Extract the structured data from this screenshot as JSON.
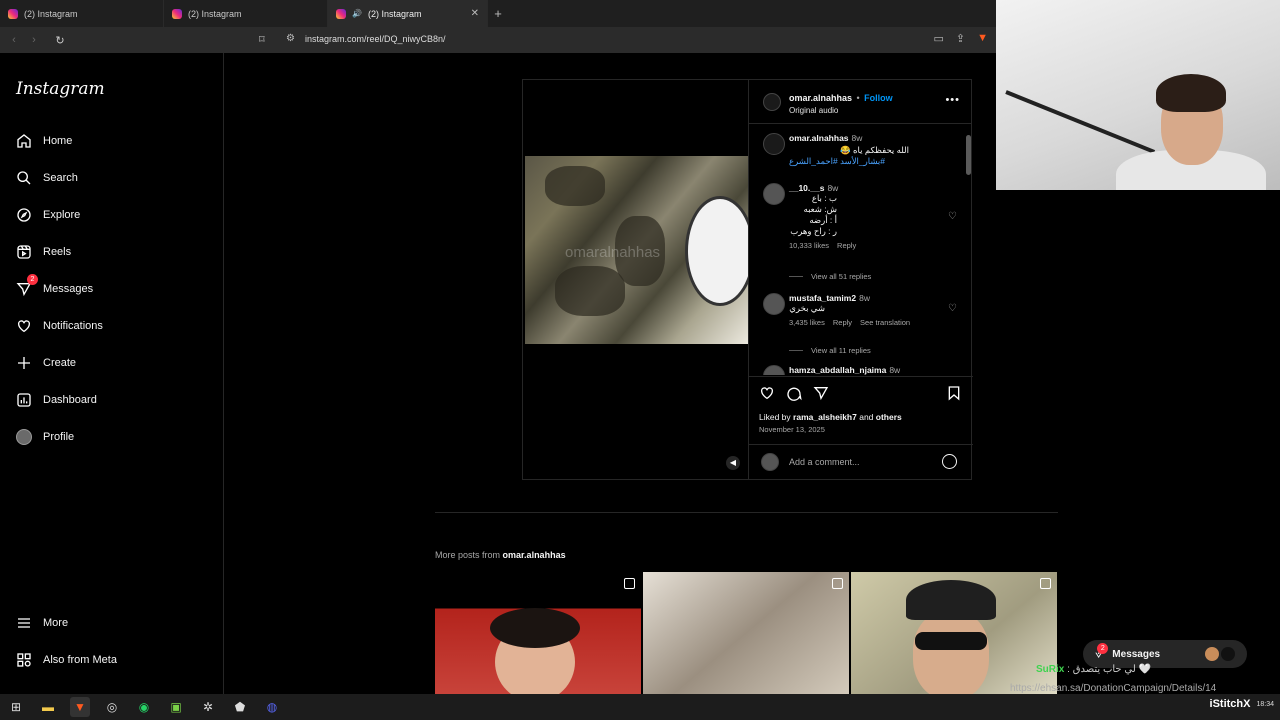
{
  "browser": {
    "tabs": [
      {
        "title": "(2) Instagram"
      },
      {
        "title": "(2) Instagram"
      },
      {
        "title": "(2) Instagram"
      }
    ],
    "new_tab": "+",
    "url": "instagram.com/reel/DQ_niwyCB8n/"
  },
  "sidebar": {
    "logo": "Instagram",
    "items": [
      {
        "label": "Home",
        "icon": "home-icon"
      },
      {
        "label": "Search",
        "icon": "search-icon"
      },
      {
        "label": "Explore",
        "icon": "compass-icon"
      },
      {
        "label": "Reels",
        "icon": "reels-icon"
      },
      {
        "label": "Messages",
        "icon": "messenger-icon",
        "badge": "2"
      },
      {
        "label": "Notifications",
        "icon": "heart-icon"
      },
      {
        "label": "Create",
        "icon": "plus-icon"
      },
      {
        "label": "Dashboard",
        "icon": "dashboard-icon"
      },
      {
        "label": "Profile",
        "icon": "avatar-icon"
      }
    ],
    "bottom": [
      {
        "label": "More",
        "icon": "menu-icon"
      },
      {
        "label": "Also from Meta",
        "icon": "meta-icon"
      }
    ]
  },
  "post": {
    "watermark": "omaralnahhas",
    "author": "omar.alnahhas",
    "follow": "Follow",
    "separator": "•",
    "audio": "Original audio",
    "caption": {
      "user": "omar.alnahhas",
      "time": "8w",
      "text": "الله يحفظكم ياه 😂",
      "tags": "#بشار_الأسد #احمد_الشرع"
    },
    "comments": [
      {
        "user": "__10.__s",
        "time": "8w",
        "lines": [
          "ب : باع",
          "ش: شعبه",
          "أ : أرضه",
          "ر : راح وهرب"
        ],
        "likes": "10,333 likes",
        "reply": "Reply",
        "view": "View all 51 replies"
      },
      {
        "user": "mustafa_tamim2",
        "time": "8w",
        "lines": [
          "شي بخري"
        ],
        "likes": "3,435 likes",
        "reply": "Reply",
        "translate": "See translation",
        "view": "View all 11 replies"
      },
      {
        "user": "hamza_abdallah_njaima",
        "time": "8w"
      }
    ],
    "liked_by_prefix": "Liked by",
    "liked_by_user": "rama_alsheikh7",
    "liked_by_and": "and",
    "liked_by_others": "others",
    "date": "November 13, 2025",
    "add_comment": "Add a comment..."
  },
  "more_posts": {
    "prefix": "More posts from",
    "user": "omar.alnahhas"
  },
  "messages_pill": {
    "label": "Messages",
    "badge": "2"
  },
  "stream_overlay": {
    "chat_user": "SuRix",
    "chat_text": "لي حاب يتصدق 🤍",
    "donation_url": "https://ehsan.sa/DonationCampaign/Details/14",
    "streamer": "iStitchX",
    "clock": "18:34"
  },
  "colors": {
    "accent": "#0095f6",
    "badge": "#ff3040",
    "bg": "#000000"
  }
}
